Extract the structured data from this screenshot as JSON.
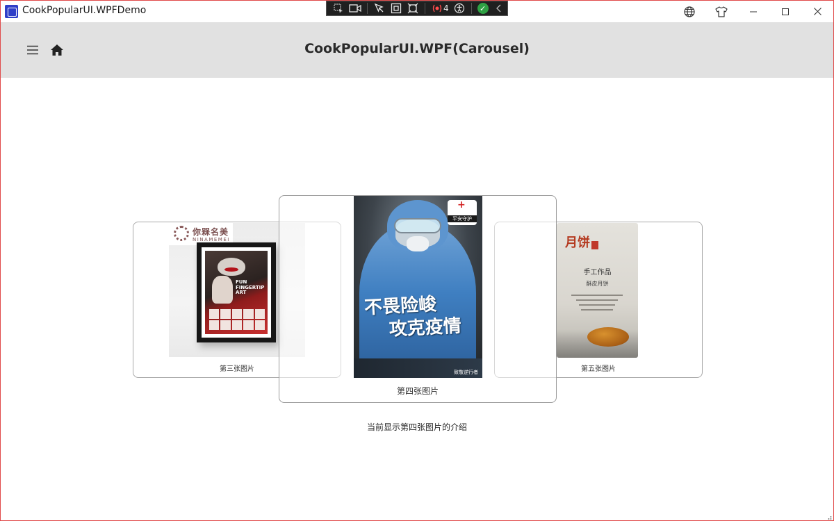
{
  "window": {
    "title": "CookPopularUI.WPFDemo",
    "colors": {
      "border": "#e04848",
      "header_bg": "#e1e1e1",
      "debug_bar": "#202020"
    }
  },
  "debug_toolbar": {
    "items": [
      "select-element-icon",
      "record-icon",
      "pointer-icon",
      "frame-icon",
      "track-icon",
      "binding-failures-icon",
      "accessibility-icon",
      "check-icon",
      "collapse-icon"
    ],
    "binding_failures_count": "4"
  },
  "titlebar_actions": {
    "items": [
      "language-globe-icon",
      "theme-shirt-icon",
      "minimize-icon",
      "maximize-icon",
      "close-icon"
    ]
  },
  "header": {
    "title": "CookPopularUI.WPF(Carousel)",
    "icons": [
      "hamburger-menu-icon",
      "home-icon"
    ]
  },
  "carousel": {
    "items": [
      {
        "caption": "第三张图片",
        "logo_cn": "你槑名美",
        "logo_en": "NINAMEMEI",
        "poster_text": "FUN FINGERTIP ART"
      },
      {
        "caption": "第四张图片",
        "badge_text": "平安守护",
        "slogan_line1": "不畏险峻",
        "slogan_line2": "攻克疫情",
        "footer_text": "致敬逆行者"
      },
      {
        "caption": "第五张图片",
        "title": "月饼",
        "subtitle": "手工作品",
        "subtitle2": "酥皮月饼"
      }
    ]
  },
  "intro_text": "当前显示第四张图片的介绍"
}
